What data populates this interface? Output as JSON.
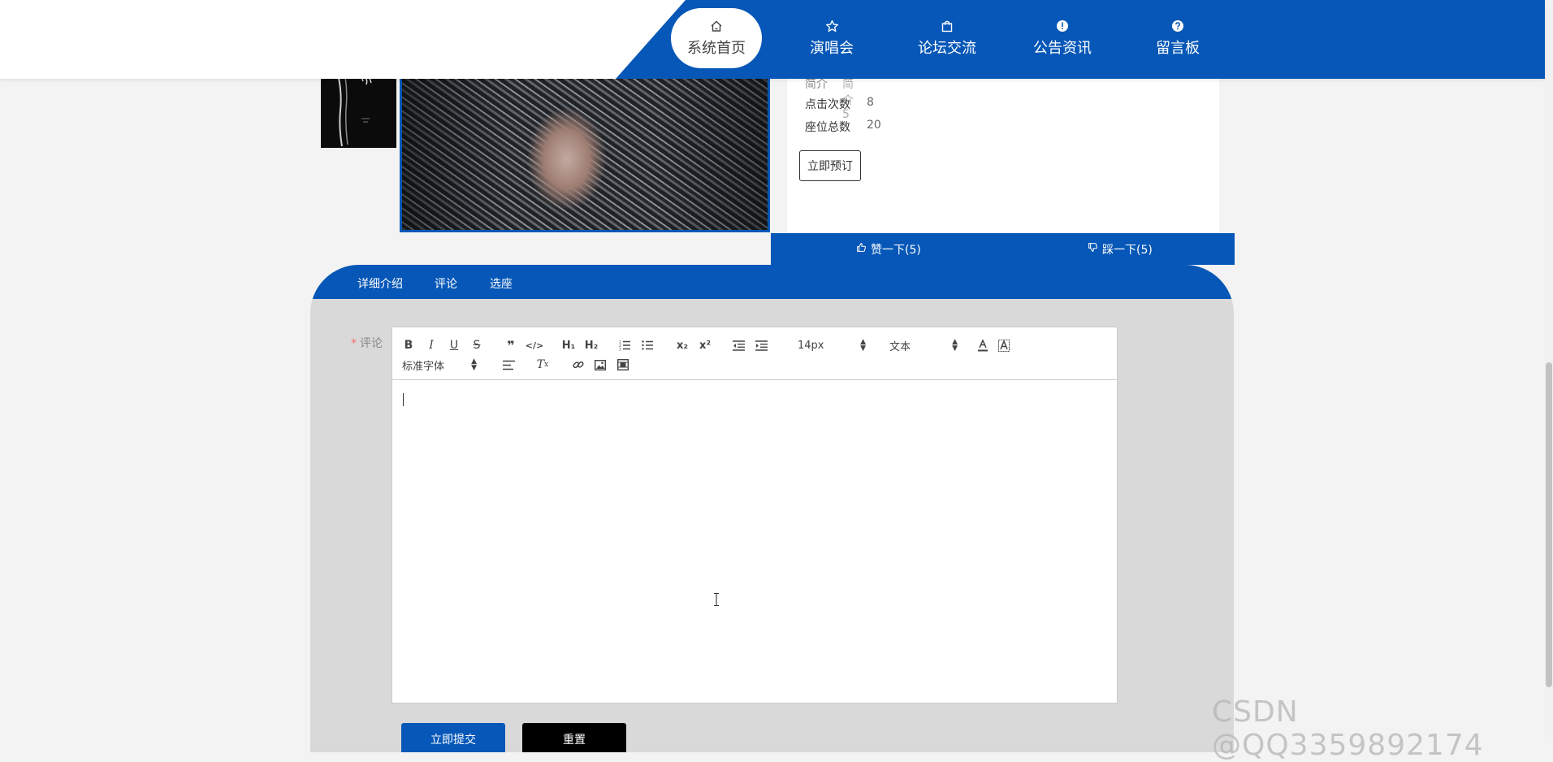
{
  "nav": {
    "items": [
      {
        "label": "系统首页",
        "icon": "home-icon"
      },
      {
        "label": "演唱会",
        "icon": "star-icon"
      },
      {
        "label": "论坛交流",
        "icon": "bag-icon"
      },
      {
        "label": "公告资讯",
        "icon": "alert-circle-icon"
      },
      {
        "label": "留言板",
        "icon": "help-circle-icon"
      }
    ],
    "active_index": 0
  },
  "colors": {
    "primary": "#0657b7",
    "panel": "#d9d9d9",
    "required": "#f56c6c"
  },
  "detail": {
    "intro_label": "简介",
    "intro_value": "简介5",
    "clicks_label": "点击次数",
    "clicks_value": "8",
    "seats_label": "座位总数",
    "seats_value": "20",
    "book_button": "立即预订"
  },
  "votes": {
    "like": "赞一下(5)",
    "dislike": "踩一下(5)"
  },
  "tabs": [
    "详细介绍",
    "评论",
    "选座"
  ],
  "comment": {
    "required_mark": "*",
    "label": "评论",
    "font_size": "14px",
    "text_type": "文本",
    "font_family": "标准字体"
  },
  "buttons": {
    "submit": "立即提交",
    "reset": "重置"
  },
  "watermark": "CSDN @QQ3359892174"
}
